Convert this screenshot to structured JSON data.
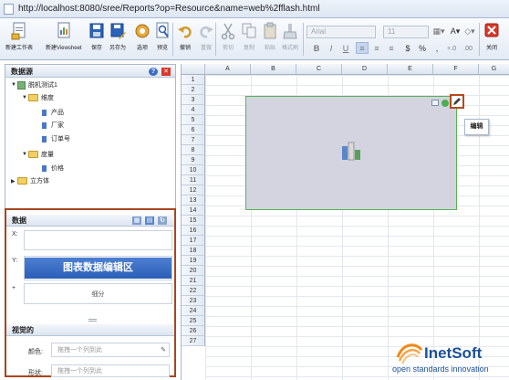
{
  "address_bar": {
    "url": "http://localhost:8080/sree/Reports?op=Resource&name=web%2fflash.html"
  },
  "toolbar": {
    "buttons": [
      {
        "label": "新建工作表",
        "icon": "new-worksheet-icon"
      },
      {
        "label": "新建Viewsheet",
        "icon": "new-viewsheet-icon"
      },
      {
        "label": "保存",
        "icon": "save-icon"
      },
      {
        "label": "另存为",
        "icon": "save-as-icon"
      },
      {
        "label": "选项",
        "icon": "options-icon"
      },
      {
        "label": "预览",
        "icon": "preview-icon"
      },
      {
        "label": "撤销",
        "icon": "undo-icon"
      },
      {
        "label": "重做",
        "icon": "redo-icon",
        "disabled": true
      },
      {
        "label": "剪切",
        "icon": "cut-icon",
        "disabled": true
      },
      {
        "label": "复制",
        "icon": "copy-icon",
        "disabled": true
      },
      {
        "label": "粘贴",
        "icon": "paste-icon",
        "disabled": true
      },
      {
        "label": "格式刷",
        "icon": "format-painter-icon",
        "disabled": true
      },
      {
        "label": "关闭",
        "icon": "close-icon"
      }
    ],
    "format": {
      "font_name": "Arial",
      "font_size": "11",
      "bold": "B",
      "italic": "I",
      "underline": "U",
      "currency": "$",
      "percent": "%",
      "comma": ","
    }
  },
  "data_source_panel": {
    "title": "数据源",
    "tree": [
      {
        "label": "脱机测试1",
        "type": "db",
        "depth": 0,
        "expanded": true
      },
      {
        "label": "维度",
        "type": "folder",
        "depth": 1,
        "expanded": true
      },
      {
        "label": "产品",
        "type": "field",
        "depth": 2
      },
      {
        "label": "厂家",
        "type": "field",
        "depth": 2
      },
      {
        "label": "订单号",
        "type": "field",
        "depth": 2
      },
      {
        "label": "度量",
        "type": "folder",
        "depth": 1,
        "expanded": true
      },
      {
        "label": "价格",
        "type": "field",
        "depth": 2
      },
      {
        "label": "立方体",
        "type": "folder",
        "depth": 0,
        "expanded": false
      }
    ]
  },
  "chart_data_panel": {
    "title": "数据",
    "x_label": "X:",
    "y_label": "Y:",
    "plus_label": "+",
    "banner": "图表数据编辑区",
    "breakdown_placeholder": "细分",
    "visual_title": "视觉的",
    "color_label": "颜色:",
    "color_placeholder": "拖拽一个列到此",
    "shape_label": "形状:",
    "shape_placeholder": "拖拽一个列到此"
  },
  "spreadsheet": {
    "columns": [
      "A",
      "B",
      "C",
      "D",
      "E",
      "F",
      "G"
    ],
    "rows": [
      "1",
      "2",
      "3",
      "4",
      "5",
      "6",
      "7",
      "8",
      "9",
      "10",
      "11",
      "12",
      "13",
      "14",
      "15",
      "16",
      "17",
      "18",
      "19",
      "20",
      "21",
      "22",
      "23",
      "24",
      "25",
      "26",
      "27"
    ]
  },
  "chart": {
    "edit_tooltip": "编辑",
    "border_color": "#56b456",
    "fill_color": "#d3d4e0"
  },
  "logo": {
    "name": "InetSoft",
    "tagline": "open standards innovation"
  }
}
